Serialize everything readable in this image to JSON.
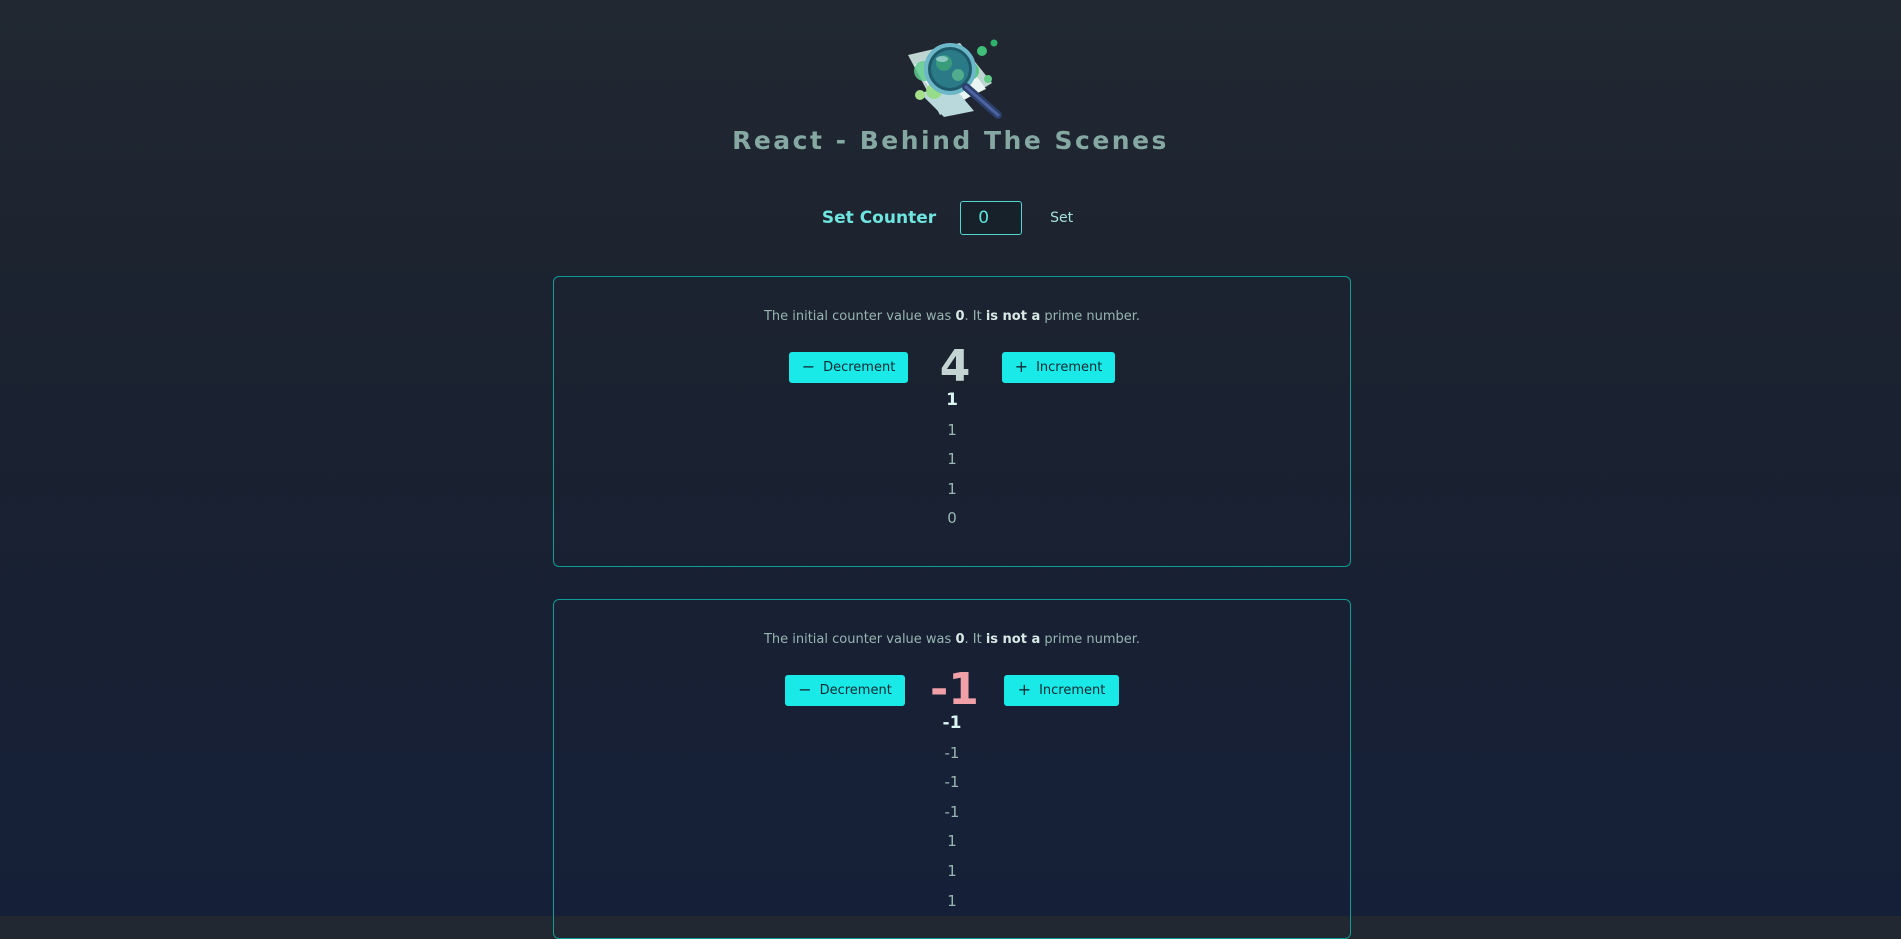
{
  "header": {
    "title": "React - Behind The Scenes",
    "logo_icon": "magnifier-over-map-logo"
  },
  "configure": {
    "label": "Set Counter",
    "input_value": "0",
    "set_button_label": "Set"
  },
  "counters": [
    {
      "info": {
        "prefix": "The initial counter value was ",
        "initial_value": "0",
        "middle": ". It ",
        "prime_phrase": "is not a",
        "suffix": " prime number."
      },
      "decrement_label": "Decrement",
      "increment_label": "Increment",
      "value": "4",
      "value_color": "#c4d4d2",
      "history": [
        "1",
        "1",
        "1",
        "1",
        "0"
      ]
    },
    {
      "info": {
        "prefix": "The initial counter value was ",
        "initial_value": "0",
        "middle": ". It ",
        "prime_phrase": "is not a",
        "suffix": " prime number."
      },
      "decrement_label": "Decrement",
      "increment_label": "Increment",
      "value": "-1",
      "value_color": "#f0a0a6",
      "history": [
        "-1",
        "-1",
        "-1",
        "-1",
        "1",
        "1",
        "1"
      ]
    }
  ],
  "colors": {
    "accent": "#19e9e7",
    "panel_border": "#0f9c95",
    "negative": "#f0a0a6"
  }
}
